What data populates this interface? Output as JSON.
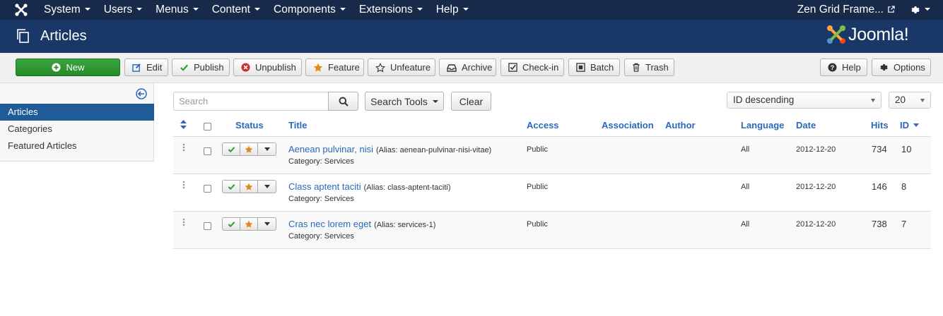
{
  "navbar": {
    "menu": [
      "System",
      "Users",
      "Menus",
      "Content",
      "Components",
      "Extensions",
      "Help"
    ],
    "site_link": "Zen Grid Frame..."
  },
  "header": {
    "title": "Articles",
    "brand": "Joomla!"
  },
  "toolbar": {
    "new": "New",
    "edit": "Edit",
    "publish": "Publish",
    "unpublish": "Unpublish",
    "feature": "Feature",
    "unfeature": "Unfeature",
    "archive": "Archive",
    "checkin": "Check-in",
    "batch": "Batch",
    "trash": "Trash",
    "help": "Help",
    "options": "Options"
  },
  "sidebar": {
    "items": [
      "Articles",
      "Categories",
      "Featured Articles"
    ]
  },
  "filters": {
    "search_placeholder": "Search",
    "search_tools": "Search Tools",
    "clear": "Clear",
    "ordering": "ID descending",
    "limit": "20"
  },
  "table": {
    "headers": {
      "status": "Status",
      "title": "Title",
      "access": "Access",
      "association": "Association",
      "author": "Author",
      "language": "Language",
      "date": "Date",
      "hits": "Hits",
      "id": "ID"
    },
    "rows": [
      {
        "title": "Aenean pulvinar, nisi",
        "alias": "(Alias: aenean-pulvinar-nisi-vitae)",
        "category": "Category: Services",
        "access": "Public",
        "language": "All",
        "date": "2012-12-20",
        "hits": "734",
        "id": "10"
      },
      {
        "title": "Class aptent taciti",
        "alias": "(Alias: class-aptent-taciti)",
        "category": "Category: Services",
        "access": "Public",
        "language": "All",
        "date": "2012-12-20",
        "hits": "146",
        "id": "8"
      },
      {
        "title": "Cras nec lorem eget",
        "alias": "(Alias: services-1)",
        "category": "Category: Services",
        "access": "Public",
        "language": "All",
        "date": "2012-12-20",
        "hits": "738",
        "id": "7"
      }
    ]
  },
  "colors": {
    "navbar": "#172a4a",
    "header": "#1a3867",
    "link": "#2a69b8",
    "success": "#2f9e32",
    "featured": "#e08a1e",
    "danger": "#c9302c"
  }
}
